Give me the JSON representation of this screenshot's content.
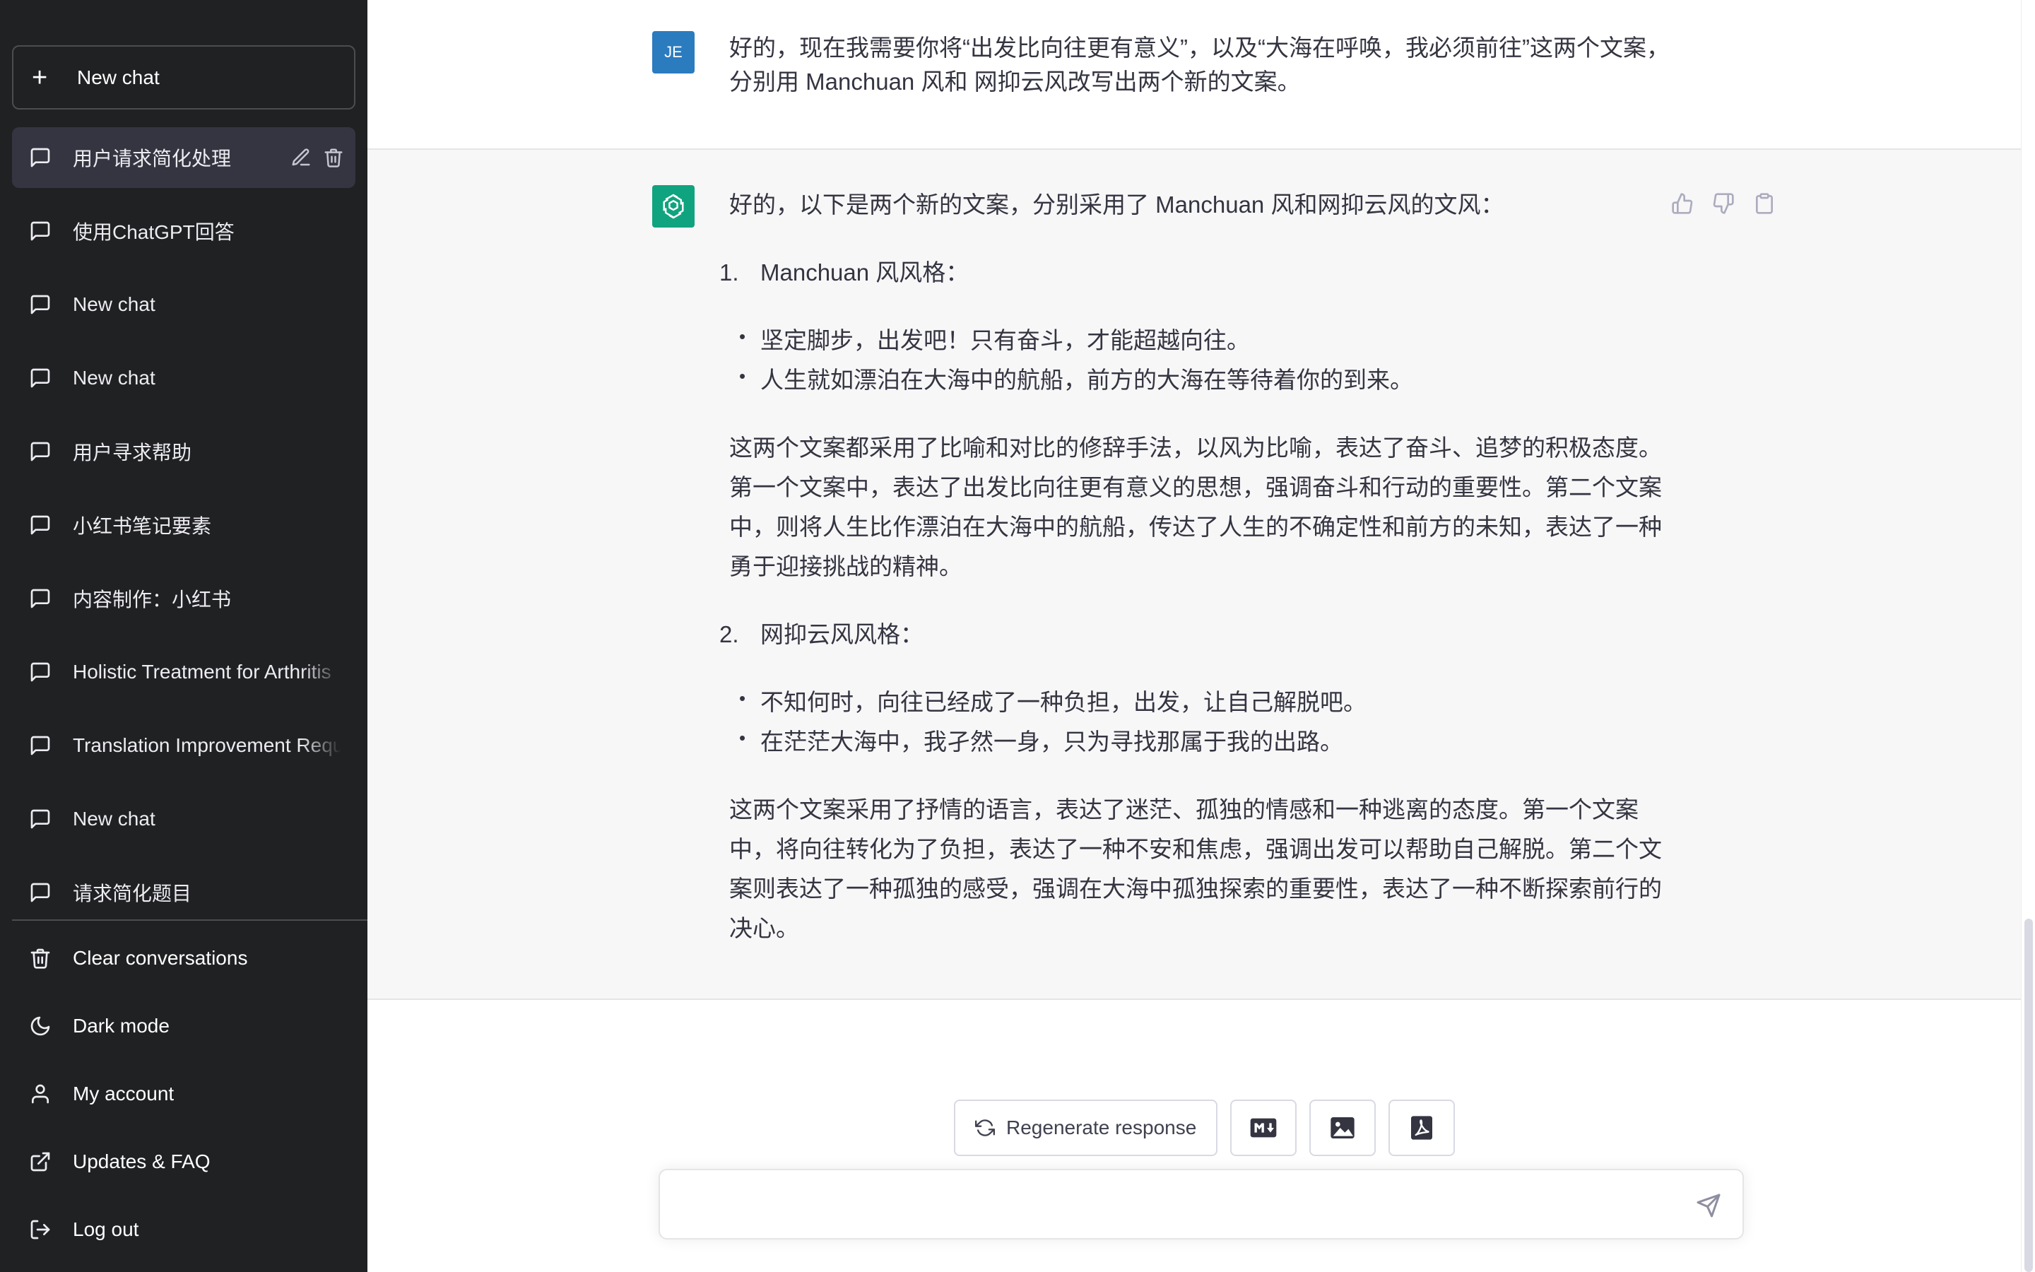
{
  "sidebar": {
    "new_chat_label": "New chat",
    "conversations": [
      {
        "label": "用户请求简化处理",
        "active": true
      },
      {
        "label": "使用ChatGPT回答"
      },
      {
        "label": "New chat"
      },
      {
        "label": "New chat"
      },
      {
        "label": "用户寻求帮助"
      },
      {
        "label": "小红书笔记要素"
      },
      {
        "label": "内容制作：小红书"
      },
      {
        "label": "Holistic Treatment for Arthritis"
      },
      {
        "label": "Translation Improvement Request"
      },
      {
        "label": "New chat"
      },
      {
        "label": "请求简化题目"
      }
    ],
    "menu": {
      "clear": "Clear conversations",
      "dark_mode": "Dark mode",
      "account": "My account",
      "updates": "Updates & FAQ",
      "logout": "Log out"
    }
  },
  "chat": {
    "user": {
      "avatar_initials": "JE",
      "text": "好的，现在我需要你将“出发比向往更有意义”，以及“大海在呼唤，我必须前往”这两个文案，分别用 Manchuan 风和 网抑云风改写出两个新的文案。"
    },
    "assistant": {
      "intro": "好的，以下是两个新的文案，分别采用了 Manchuan 风和网抑云风的文风：",
      "sections": [
        {
          "number": "1.",
          "title": "Manchuan 风风格：",
          "bullets": [
            "坚定脚步，出发吧！只有奋斗，才能超越向往。",
            "人生就如漂泊在大海中的航船，前方的大海在等待着你的到来。"
          ],
          "paragraph": "这两个文案都采用了比喻和对比的修辞手法，以风为比喻，表达了奋斗、追梦的积极态度。第一个文案中，表达了出发比向往更有意义的思想，强调奋斗和行动的重要性。第二个文案中，则将人生比作漂泊在大海中的航船，传达了人生的不确定性和前方的未知，表达了一种勇于迎接挑战的精神。"
        },
        {
          "number": "2.",
          "title": "网抑云风风格：",
          "bullets": [
            "不知何时，向往已经成了一种负担，出发，让自己解脱吧。",
            "在茫茫大海中，我孑然一身，只为寻找那属于我的出路。"
          ],
          "paragraph": "这两个文案采用了抒情的语言，表达了迷茫、孤独的情感和一种逃离的态度。第一个文案中，将向往转化为了负担，表达了一种不安和焦虑，强调出发可以帮助自己解脱。第二个文案则表达了一种孤独的感受，强调在大海中孤独探索的重要性，表达了一种不断探索前行的决心。"
        }
      ]
    }
  },
  "bottom": {
    "regenerate_label": "Regenerate response",
    "input_value": "",
    "input_placeholder": ""
  },
  "colors": {
    "sidebar_bg": "#202123",
    "active_item_bg": "#343541",
    "assistant_bg": "#f7f7f8",
    "bot_avatar": "#10a37f",
    "user_avatar": "#2b7bbf"
  }
}
